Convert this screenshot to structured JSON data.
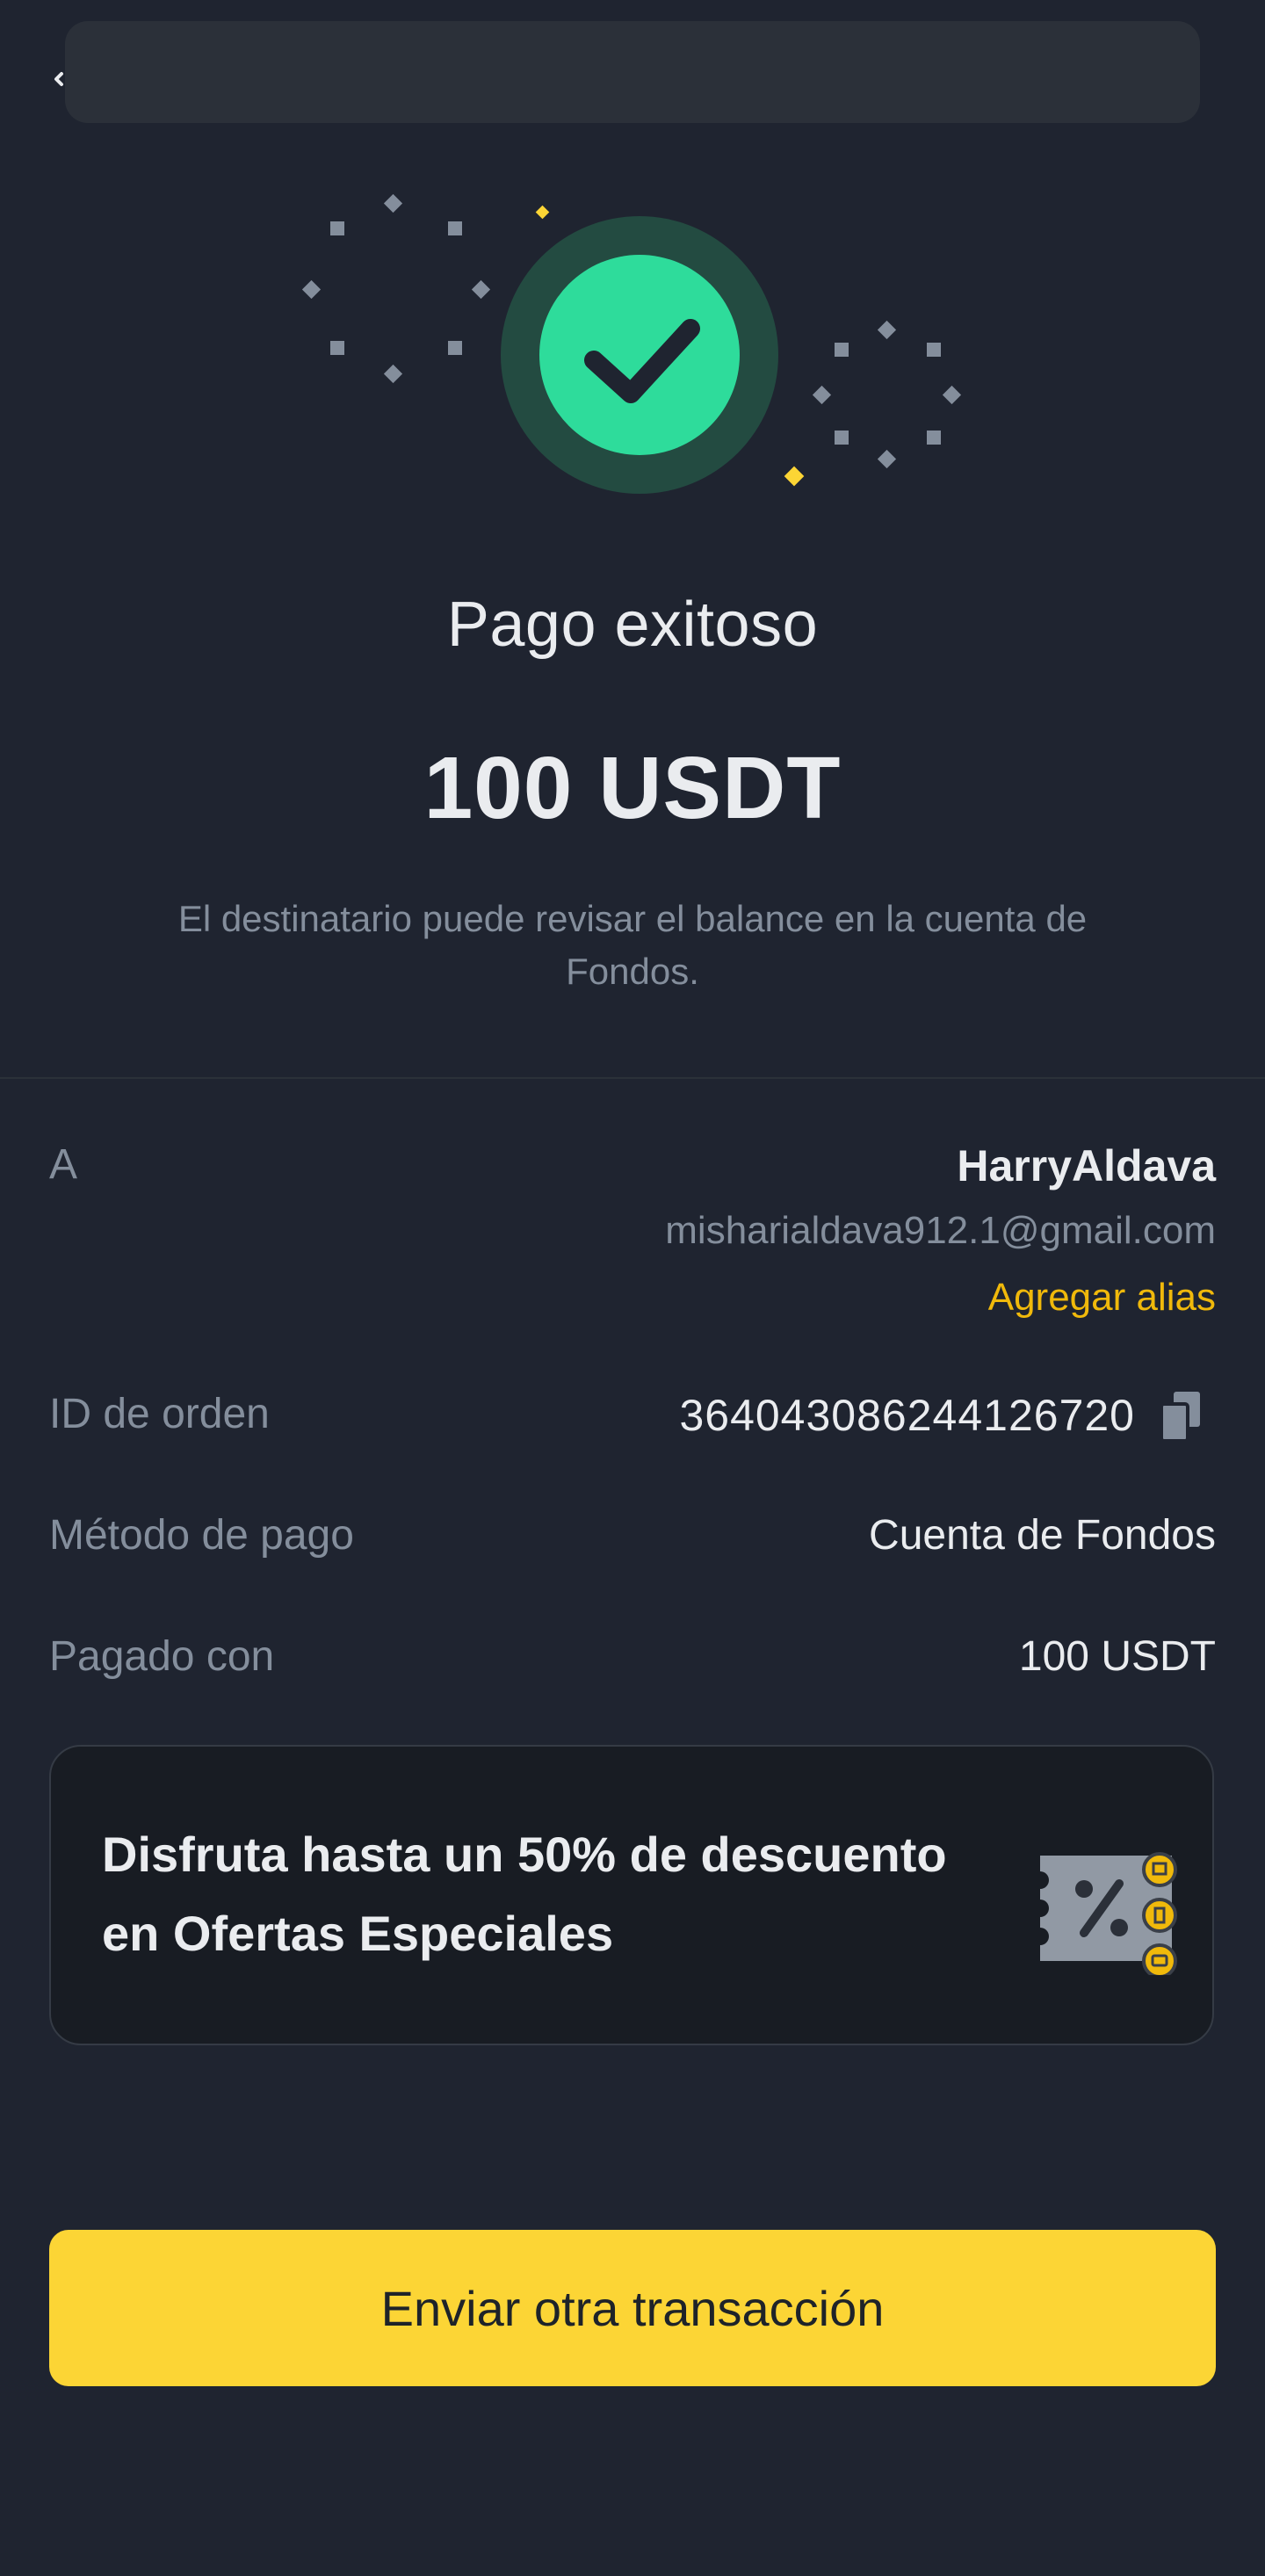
{
  "status": {
    "title": "Pago exitoso",
    "amount": "100 USDT",
    "message": "El destinatario puede revisar el balance en la cuenta de Fondos.",
    "icon": "check-circle-icon"
  },
  "details": {
    "recipient": {
      "label": "A",
      "name": "HarryAldava",
      "email": "misharialdava912.1@gmail.com",
      "add_alias": "Agregar alias"
    },
    "order": {
      "label": "ID de orden",
      "value": "364043086244126720",
      "copy_icon": "copy-icon"
    },
    "payment_method": {
      "label": "Método de pago",
      "value": "Cuenta de Fondos"
    },
    "paid_with": {
      "label": "Pagado con",
      "value": "100 USDT"
    }
  },
  "promo": {
    "text": "Disfruta hasta un 50% de descuento en Ofertas Especiales",
    "icon": "discount-coupon-icon"
  },
  "cta": {
    "label": "Enviar otra transacción"
  },
  "colors": {
    "background": "#1f2430",
    "success": "#2ed69a",
    "accent": "#f0b90b",
    "button": "#fcd535"
  }
}
